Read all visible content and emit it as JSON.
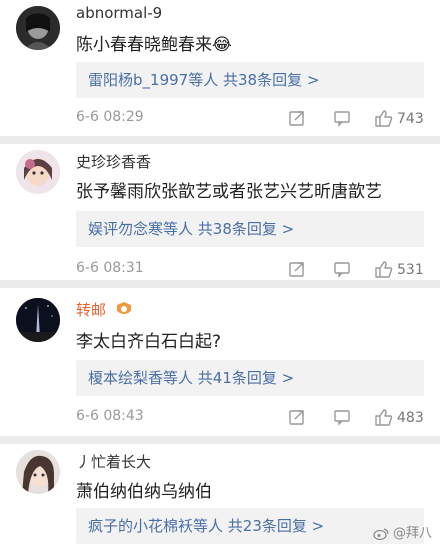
{
  "comments": [
    {
      "username": "abnormal-9",
      "text": "陈小春春晓鲍春来😂",
      "reply_users": "雷阳杨b_1997等人",
      "reply_count": "共38条回复 >",
      "time": "6-6 08:29",
      "likes": "743"
    },
    {
      "username": "史珍珍香香",
      "text": "张予馨雨欣张歆艺或者张艺兴艺昕唐歆艺",
      "reply_users": "娱评勿念寒等人",
      "reply_count": "共38条回复 >",
      "time": "6-6 08:31",
      "likes": "531"
    },
    {
      "username": "转邮",
      "text": "李太白齐白石白起?",
      "reply_users": "榎本绘梨香等人",
      "reply_count": "共41条回复 >",
      "time": "6-6 08:43",
      "likes": "483"
    },
    {
      "username": "丿忙着长大",
      "text": "萧伯纳伯纳乌纳伯",
      "reply_users": "疯子的小花棉袄等人",
      "reply_count": "共23条回复 >",
      "time": "",
      "likes": ""
    }
  ],
  "watermark": "@拜八",
  "colors": {
    "link": "#4a6fa5",
    "meta": "#9a9a9a",
    "divider": "#ececec",
    "reply_bg": "#f2f2f2"
  }
}
